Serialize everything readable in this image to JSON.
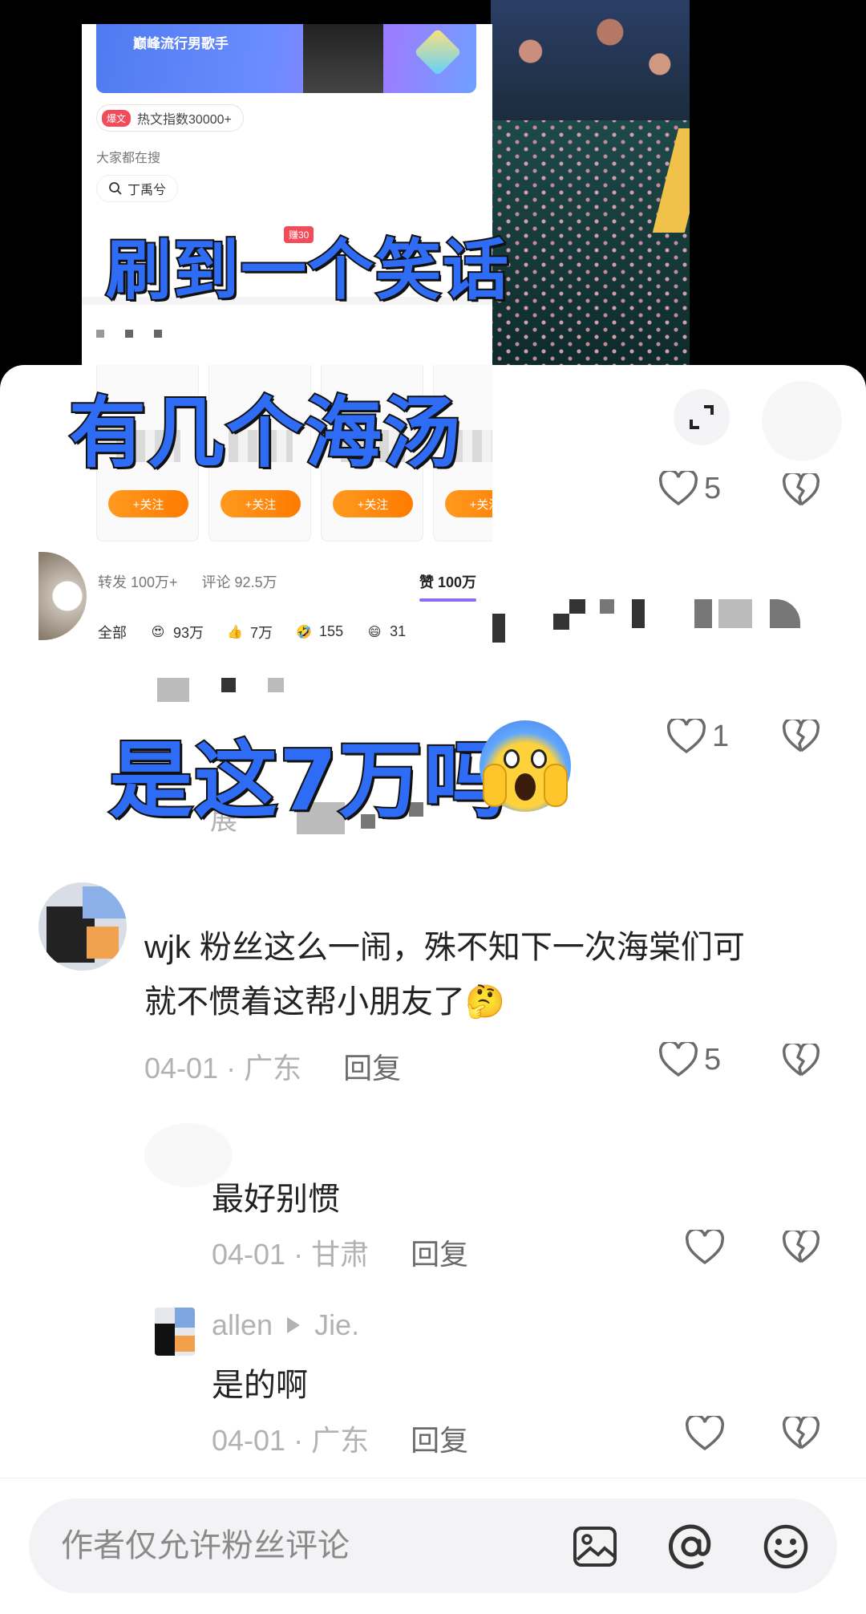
{
  "top_shot": {
    "banner_title": "巅峰流行男歌手",
    "hot_tag": "爆文",
    "hot_index": "热文指数30000+",
    "everyone_searching": "大家都在搜",
    "search_term": "丁禹兮",
    "partial_chip": "赚30"
  },
  "follow_button_label": "+关注",
  "stats": {
    "repost": "转发 100万+",
    "comments": "评论 92.5万",
    "likes": "赞 100万"
  },
  "reactions": [
    {
      "label": "全部"
    },
    {
      "emoji": "😍",
      "count": "93万"
    },
    {
      "emoji": "👍",
      "count": "7万"
    },
    {
      "emoji": "🤣",
      "count": "155"
    },
    {
      "emoji": "😄",
      "count": "31"
    }
  ],
  "captions": {
    "line1": "刷到一个笑话",
    "line2": "有几个海汤",
    "line3": "是这7万吗"
  },
  "comments": [
    {
      "likes": "5"
    },
    {
      "likes": "1",
      "partial_text": "展"
    },
    {
      "text_line1": "wjk 粉丝这么一闹，殊不知下一次海棠们可",
      "text_line2": "就不惯着这帮小朋友了",
      "date": "04-01 · 广东",
      "reply": "回复",
      "likes": "5"
    },
    {
      "text": "最好别惯",
      "date": "04-01 · 甘肃",
      "reply": "回复"
    },
    {
      "user": "allen",
      "reply_to": "Jie.",
      "text": "是的啊",
      "date": "04-01 · 广东",
      "reply": "回复"
    }
  ],
  "input": {
    "placeholder": "作者仅允许粉丝评论"
  },
  "colors": {
    "caption_blue": "#2f6cf5",
    "follow_orange": "#ff8a0f",
    "likes_underline": "#8e6cf2"
  },
  "icons": [
    "expand-icon",
    "heart-icon",
    "broken-heart-icon",
    "image-icon",
    "at-icon",
    "emoji-icon",
    "search-icon"
  ]
}
